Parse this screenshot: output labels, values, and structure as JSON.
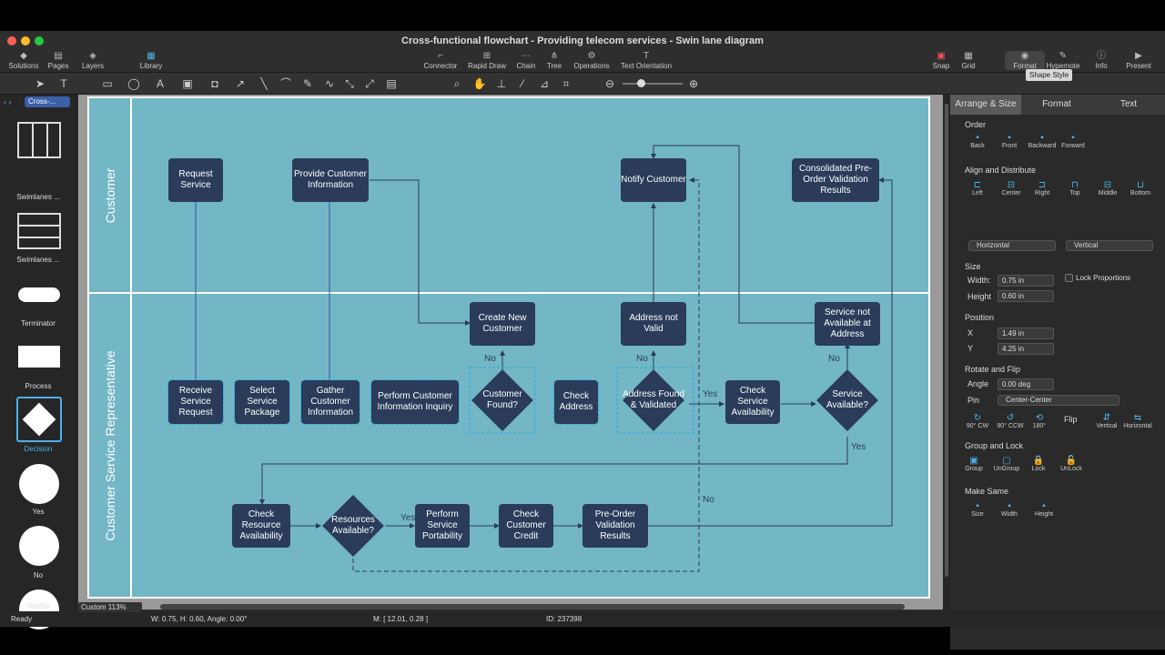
{
  "window": {
    "title": "Cross-functional flowchart - Providing telecom services - Swin lane diagram"
  },
  "toolbar": {
    "left": [
      "Solutions",
      "Pages",
      "Layers",
      "Library"
    ],
    "center": [
      "Connector",
      "Rapid Draw",
      "Chain",
      "Tree",
      "Operations",
      "Text Orientation"
    ],
    "right": [
      "Snap",
      "Grid",
      "Format",
      "Hypernote",
      "Info",
      "Present"
    ],
    "tooltip": "Shape Style"
  },
  "library": {
    "dropdown": "Cross-...",
    "items": [
      "Swimlanes ...",
      "Swimlanes ...",
      "Terminator",
      "Process",
      "Decision",
      "Yes",
      "No",
      "Yes/No"
    ]
  },
  "canvas": {
    "lanes": [
      "Customer",
      "Customer Service Representative"
    ],
    "nodes": {
      "request_service": "Request Service",
      "provide_info": "Provide Customer Information",
      "notify_customer": "Notify Customer",
      "consolidated": "Consolidated Pre-Order Validation Results",
      "create_customer": "Create New Customer",
      "address_not_valid": "Address not Valid",
      "service_not_available": "Service not Available at Address",
      "receive_request": "Receive Service Request",
      "select_package": "Select Service Package",
      "gather_info": "Gather Customer Information",
      "inquiry": "Perform Customer Information Inquiry",
      "customer_found": "Customer Found?",
      "check_address": "Check Address",
      "address_found": "Address Found & Validated",
      "check_service": "Check Service Availability",
      "service_available": "Service Available?",
      "check_resource": "Check Resource Availability",
      "resources_available": "Resources Available?",
      "portability": "Perform Service Portability",
      "check_credit": "Check Customer Credit",
      "preorder_results": "Pre-Order Validation Results"
    },
    "labels": {
      "no1": "No",
      "no2": "No",
      "no3": "No",
      "no4": "No",
      "yes1": "Yes",
      "yes2": "Yes",
      "yes3": "Yes"
    }
  },
  "panel": {
    "tabs": [
      "Arrange & Size",
      "Format",
      "Text"
    ],
    "order": {
      "title": "Order",
      "items": [
        "Back",
        "Front",
        "Backward",
        "Forward"
      ]
    },
    "align": {
      "title": "Align and Distribute",
      "items": [
        "Left",
        "Center",
        "Right",
        "Top",
        "Middle",
        "Bottom"
      ],
      "horizontal": "Horizontal",
      "vertical": "Vertical"
    },
    "size": {
      "title": "Size",
      "width_label": "Width:",
      "width": "0.75 in",
      "height_label": "Height",
      "height": "0.60 in",
      "lock": "Lock Proportions"
    },
    "position": {
      "title": "Position",
      "x_label": "X",
      "x": "1.49 in",
      "y_label": "Y",
      "y": "4.25 in"
    },
    "rotate": {
      "title": "Rotate and Flip",
      "angle_label": "Angle",
      "angle": "0.00 deg",
      "pin_label": "Pin",
      "pin": "Center-Center",
      "items": [
        "90° CW",
        "90° CCW",
        "180°"
      ],
      "flip": "Flip",
      "flip_items": [
        "Vertical",
        "Horizontal"
      ]
    },
    "group": {
      "title": "Group and Lock",
      "items": [
        "Group",
        "UnGroup",
        "Lock",
        "UnLock"
      ]
    },
    "make_same": {
      "title": "Make Same",
      "items": [
        "Size",
        "Width",
        "Height"
      ]
    }
  },
  "status": {
    "zoom": "Custom 113%",
    "ready": "Ready",
    "dims": "W: 0.75,  H: 0.60,  Angle: 0.00°",
    "mouse": "M: [ 12.01, 0.28 ]",
    "id": "ID: 237398"
  }
}
